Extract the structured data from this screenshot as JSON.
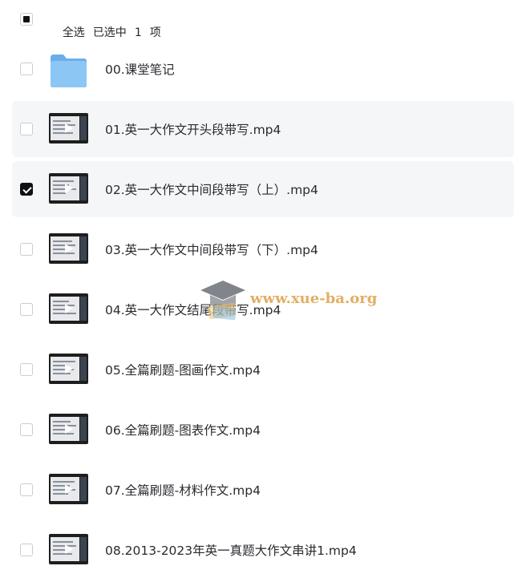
{
  "header": {
    "select_all_label": "全选",
    "selected_text": "已选中",
    "selected_count": "1",
    "unit": "项"
  },
  "files": [
    {
      "name": "00.课堂笔记",
      "type": "folder",
      "checked": false
    },
    {
      "name": "01.英一大作文开头段带写.mp4",
      "type": "video",
      "checked": false
    },
    {
      "name": "02.英一大作文中间段带写（上）.mp4",
      "type": "video",
      "checked": true
    },
    {
      "name": "03.英一大作文中间段带写（下）.mp4",
      "type": "video",
      "checked": false
    },
    {
      "name": "04.英一大作文结尾段带写.mp4",
      "type": "video",
      "checked": false
    },
    {
      "name": "05.全篇刷题-图画作文.mp4",
      "type": "video",
      "checked": false
    },
    {
      "name": "06.全篇刷题-图表作文.mp4",
      "type": "video",
      "checked": false
    },
    {
      "name": "07.全篇刷题-材料作文.mp4",
      "type": "video",
      "checked": false
    },
    {
      "name": "08.2013-2023年英一真题大作文串讲1.mp4",
      "type": "video",
      "checked": false
    }
  ],
  "watermark": {
    "text": "www.xue-ba.org"
  },
  "colors": {
    "folder": "#7fbdf2",
    "selected_bg": "#f5f6f8",
    "checkbox_checked": "#111111",
    "watermark": "#dea046"
  }
}
